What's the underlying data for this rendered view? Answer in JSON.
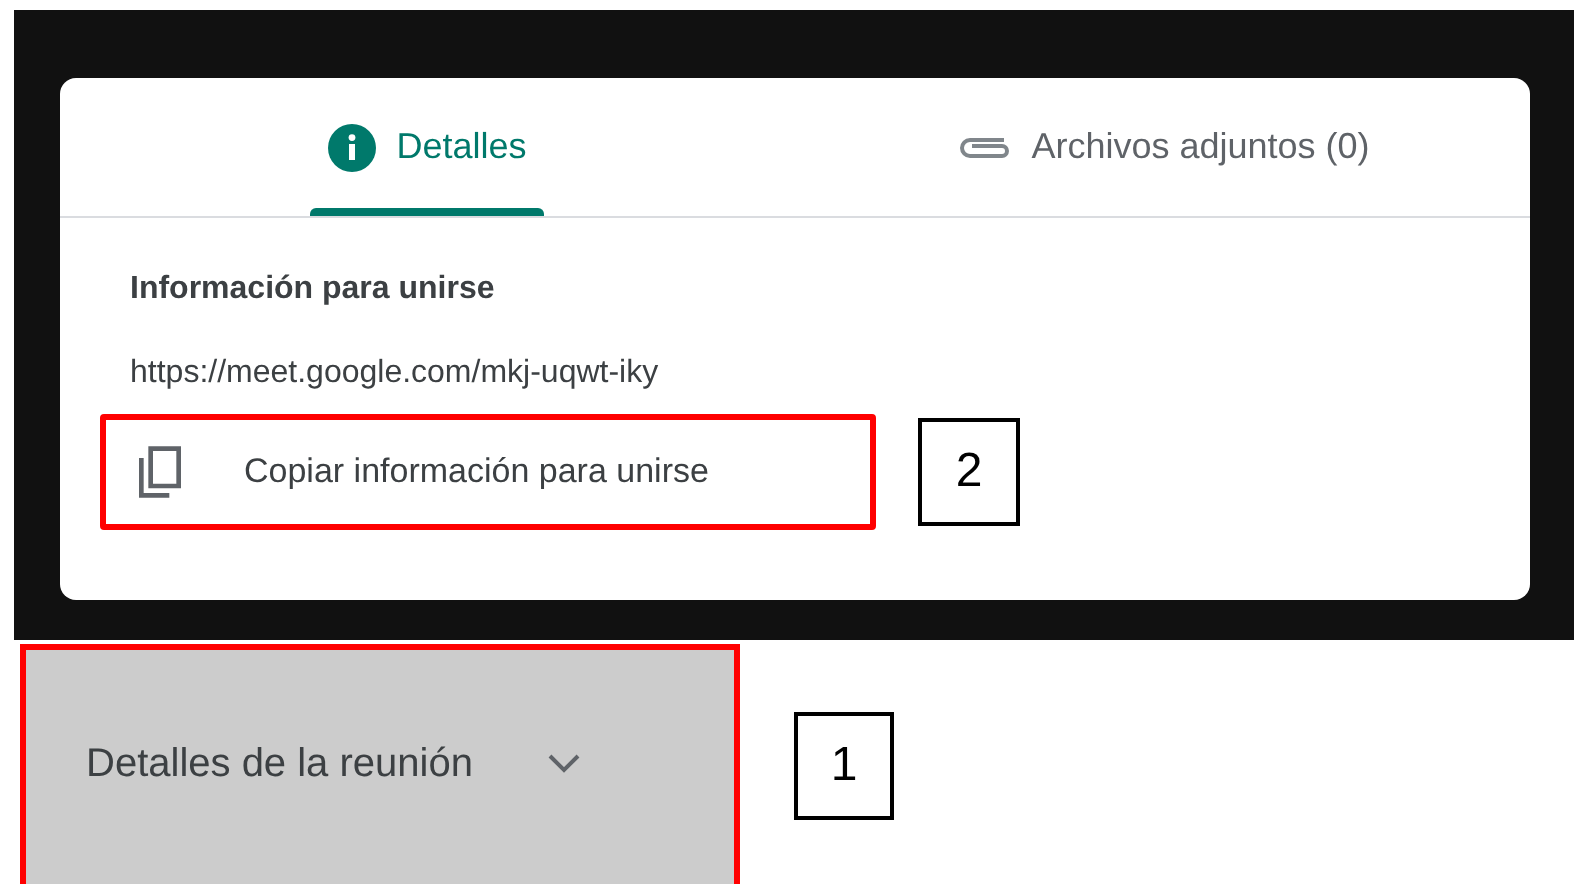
{
  "tabs": [
    {
      "label": "Detalles",
      "kind": "info",
      "selected": true
    },
    {
      "label": "Archivos adjuntos (0)",
      "kind": "attachment",
      "selected": false
    }
  ],
  "join_info": {
    "title": "Información para unirse",
    "url": "https://meet.google.com/mkj-uqwt-iky",
    "copy_button": {
      "label": "Copiar información para unirse",
      "highlighted": true
    }
  },
  "meeting_details_button": {
    "label": "Detalles de la reunión",
    "highlighted": true
  },
  "callouts": [
    "2",
    "1"
  ]
}
